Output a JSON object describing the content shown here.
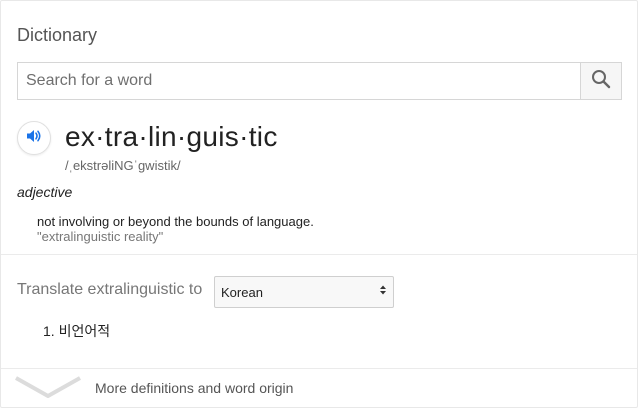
{
  "header": {
    "title": "Dictionary"
  },
  "search": {
    "placeholder": "Search for a word",
    "value": ""
  },
  "entry": {
    "word": "ex·tra·lin·guis·tic",
    "phonetic": "/ˌekstrəliNGˈgwistik/",
    "part_of_speech": "adjective",
    "definition": "not involving or beyond the bounds of language.",
    "example": "\"extralinguistic reality\""
  },
  "translate": {
    "label": "Translate extralinguistic to",
    "selected_language": "Korean",
    "results": [
      "1. 비언어적"
    ]
  },
  "footer": {
    "more_label": "More definitions and word origin"
  },
  "colors": {
    "speaker_blue": "#1a73e8",
    "divider": "#ebebeb"
  },
  "icons": {
    "search": "search-icon",
    "speaker": "speaker-icon",
    "select": "updown-arrow-icon",
    "more": "chevron-down-icon"
  }
}
